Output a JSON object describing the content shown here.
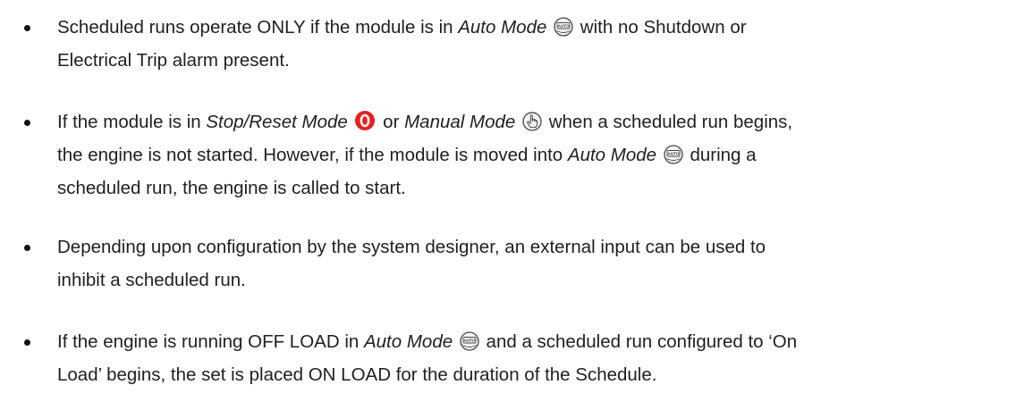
{
  "bullets": [
    {
      "t1": "Scheduled runs operate ONLY if the module is in ",
      "mode1": "Auto Mode",
      "icon1": "auto-mode-icon",
      "t2": " with no Shutdown or",
      "t3": "Electrical Trip alarm present."
    },
    {
      "t1": "If the module is in ",
      "mode1": "Stop/Reset Mode",
      "icon1": "stop-reset-icon",
      "t2": " or ",
      "mode2": "Manual Mode",
      "icon2": "manual-mode-icon",
      "t3": " when a scheduled run begins,",
      "t4": "the engine is not started. However, if the module is moved into ",
      "mode3": "Auto Mode",
      "icon3": "auto-mode-icon",
      "t5": " during a",
      "t6": "scheduled run, the engine is called to start."
    },
    {
      "t1": "Depending upon configuration by the system designer, an external input can be used to",
      "t2": "inhibit a scheduled run."
    },
    {
      "t1": "If the engine is running OFF LOAD in ",
      "mode1": "Auto Mode",
      "icon1": "auto-mode-icon",
      "t2": " and a scheduled run configured to ‘On",
      "t3": "Load’ begins, the set is placed ON LOAD for the duration of the Schedule."
    }
  ],
  "icons": {
    "auto_label": "AUTO",
    "stop_label": "O",
    "stop_color": "#e0221f"
  }
}
